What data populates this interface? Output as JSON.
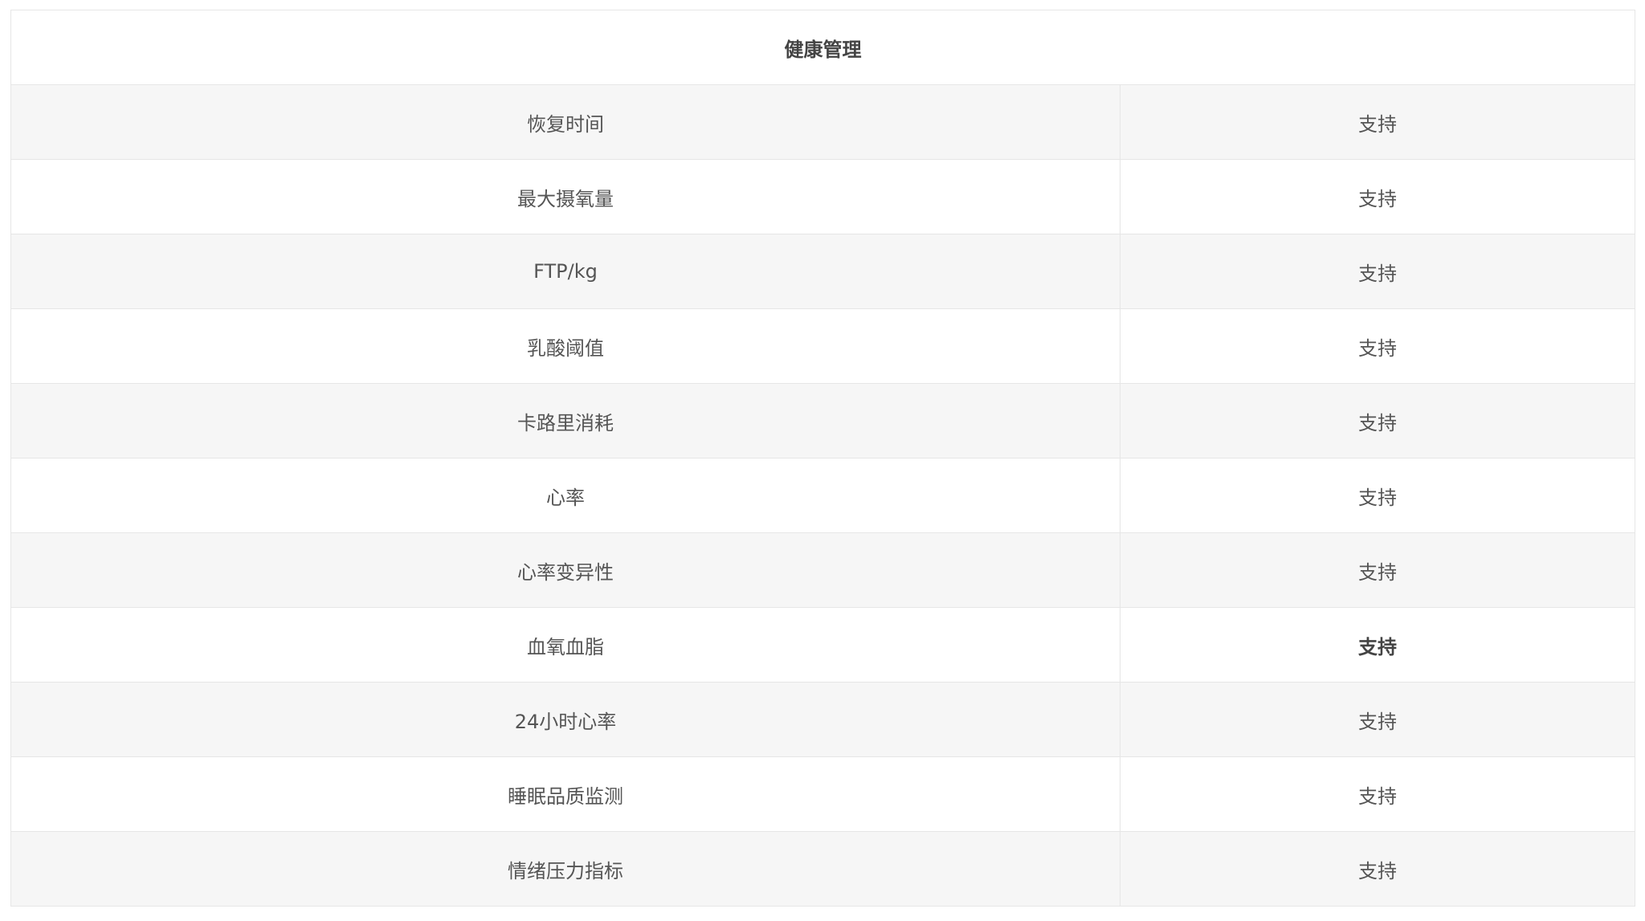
{
  "section_title": "健康管理",
  "rows": [
    {
      "feature": "恢复时间",
      "value": "支持"
    },
    {
      "feature": "最大摄氧量",
      "value": "支持"
    },
    {
      "feature": "FTP/kg",
      "value": "支持"
    },
    {
      "feature": "乳酸阈值",
      "value": "支持"
    },
    {
      "feature": "卡路里消耗",
      "value": "支持"
    },
    {
      "feature": "心率",
      "value": "支持"
    },
    {
      "feature": "心率变异性",
      "value": "支持"
    },
    {
      "feature": "血氧血脂",
      "value": "支持"
    },
    {
      "feature": "24小时心率",
      "value": "支持"
    },
    {
      "feature": "睡眠品质监测",
      "value": "支持"
    },
    {
      "feature": "情绪压力指标",
      "value": "支持"
    }
  ],
  "colors": {
    "row_shade": "#f6f6f6",
    "border": "#e6e6e6",
    "text": "#555555"
  }
}
